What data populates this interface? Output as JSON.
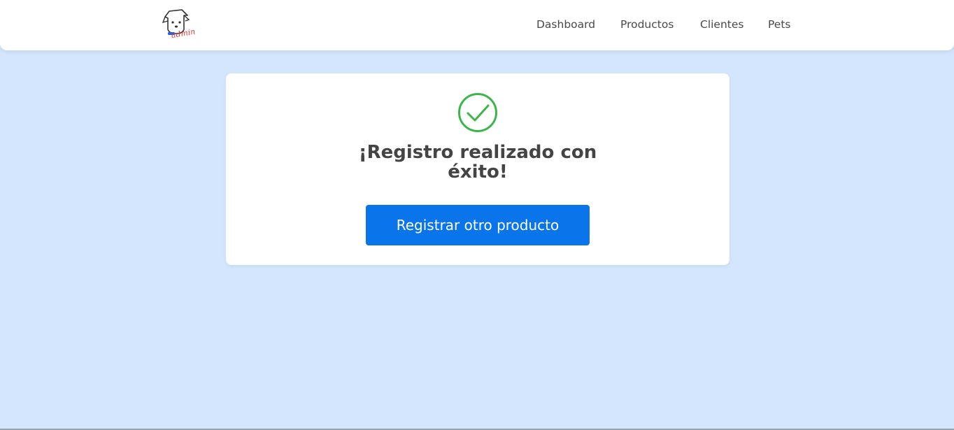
{
  "header": {
    "logo": {
      "icon": "dog-admin-logo-icon",
      "text": "admin"
    },
    "nav": [
      {
        "label": "Dashboard"
      },
      {
        "label": "Productos"
      },
      {
        "label": "Clientes"
      },
      {
        "label": "Pets"
      }
    ]
  },
  "result": {
    "icon": "check-circle-icon",
    "title": "¡Registro realizado con éxito!",
    "button_label": "Registrar otro producto"
  },
  "colors": {
    "background": "#d3e6fd",
    "accent": "#0a74ea",
    "success": "#3cb54a"
  }
}
